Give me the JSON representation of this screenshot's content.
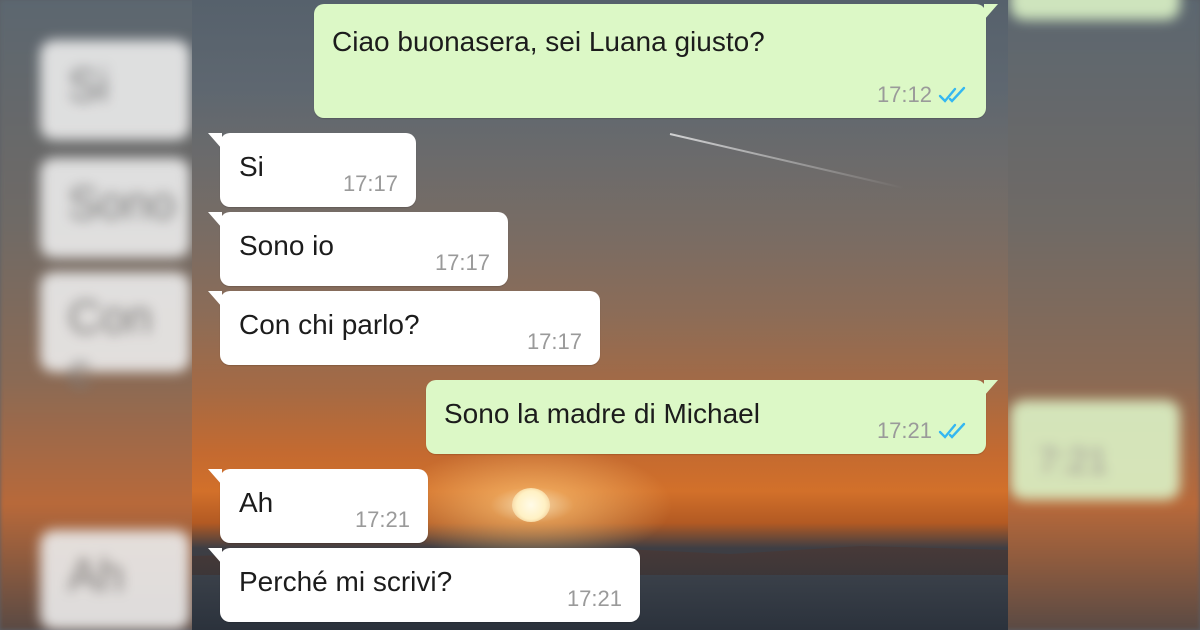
{
  "background_blur": {
    "left_labels": [
      "Si",
      "Sono",
      "Con c",
      "Ah"
    ],
    "right_time": "7:21"
  },
  "messages": [
    {
      "direction": "out",
      "text": "Ciao buonasera, sei Luana giusto?",
      "time": "17:12",
      "status": "read"
    },
    {
      "direction": "in",
      "text": "Si",
      "time": "17:17"
    },
    {
      "direction": "in",
      "text": "Sono io",
      "time": "17:17"
    },
    {
      "direction": "in",
      "text": "Con chi parlo?",
      "time": "17:17"
    },
    {
      "direction": "out",
      "text": "Sono la madre di Michael",
      "time": "17:21",
      "status": "read"
    },
    {
      "direction": "in",
      "text": "Ah",
      "time": "17:21"
    },
    {
      "direction": "in",
      "text": "Perché mi scrivi?",
      "time": "17:21"
    }
  ],
  "colors": {
    "outgoing_bubble": "#dcf8c6",
    "incoming_bubble": "#ffffff",
    "read_ticks": "#34b7f1",
    "timestamp": "#9a9a9a"
  },
  "icons": {
    "read_receipt": "double-check-icon"
  }
}
